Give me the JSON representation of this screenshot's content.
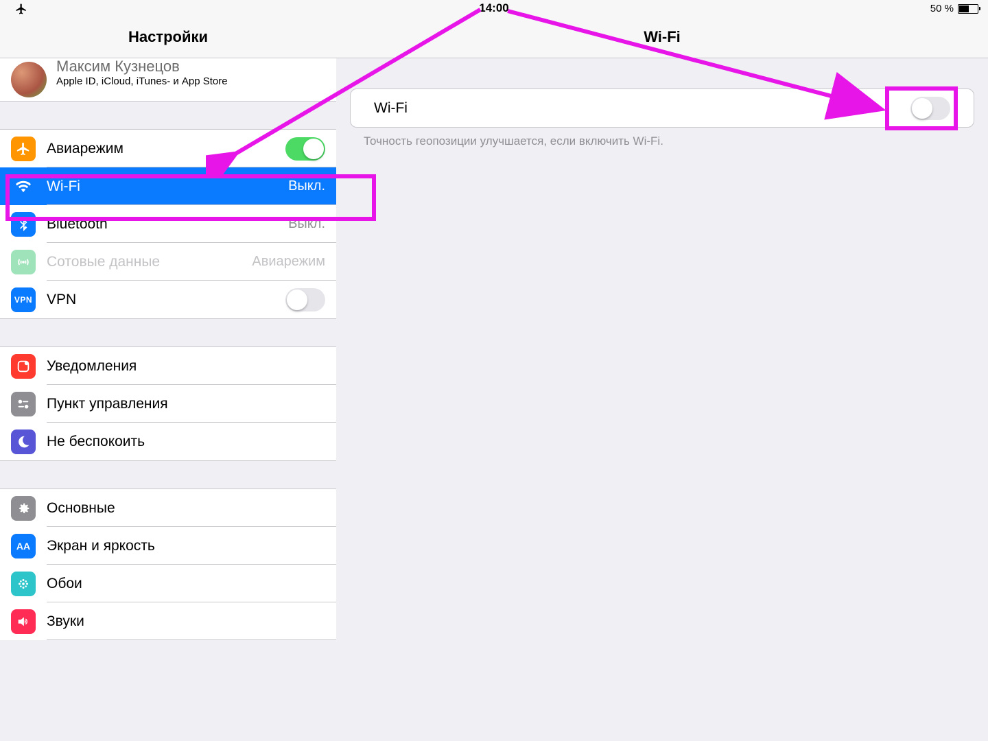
{
  "status": {
    "time": "14:00",
    "battery_text": "50 %"
  },
  "sidebar": {
    "title": "Настройки",
    "account": {
      "name": "Максим Кузнецов",
      "subtitle": "Apple ID, iCloud, iTunes- и App Store"
    },
    "group1": {
      "airplane": {
        "label": "Авиарежим"
      },
      "wifi": {
        "label": "Wi-Fi",
        "value": "Выкл."
      },
      "bt": {
        "label": "Bluetooth",
        "value": "Выкл."
      },
      "cell": {
        "label": "Сотовые данные",
        "value": "Авиарежим"
      },
      "vpn": {
        "label": "VPN",
        "badge": "VPN"
      }
    },
    "group2": {
      "notifications": {
        "label": "Уведомления"
      },
      "control_center": {
        "label": "Пункт управления"
      },
      "dnd": {
        "label": "Не беспокоить"
      }
    },
    "group3": {
      "general": {
        "label": "Основные"
      },
      "display": {
        "label": "Экран и яркость"
      },
      "wallpaper": {
        "label": "Обои"
      },
      "sounds": {
        "label": "Звуки"
      }
    }
  },
  "detail": {
    "title": "Wi-Fi",
    "row": {
      "label": "Wi-Fi"
    },
    "hint": "Точность геопозиции улучшается, если включить Wi-Fi."
  }
}
